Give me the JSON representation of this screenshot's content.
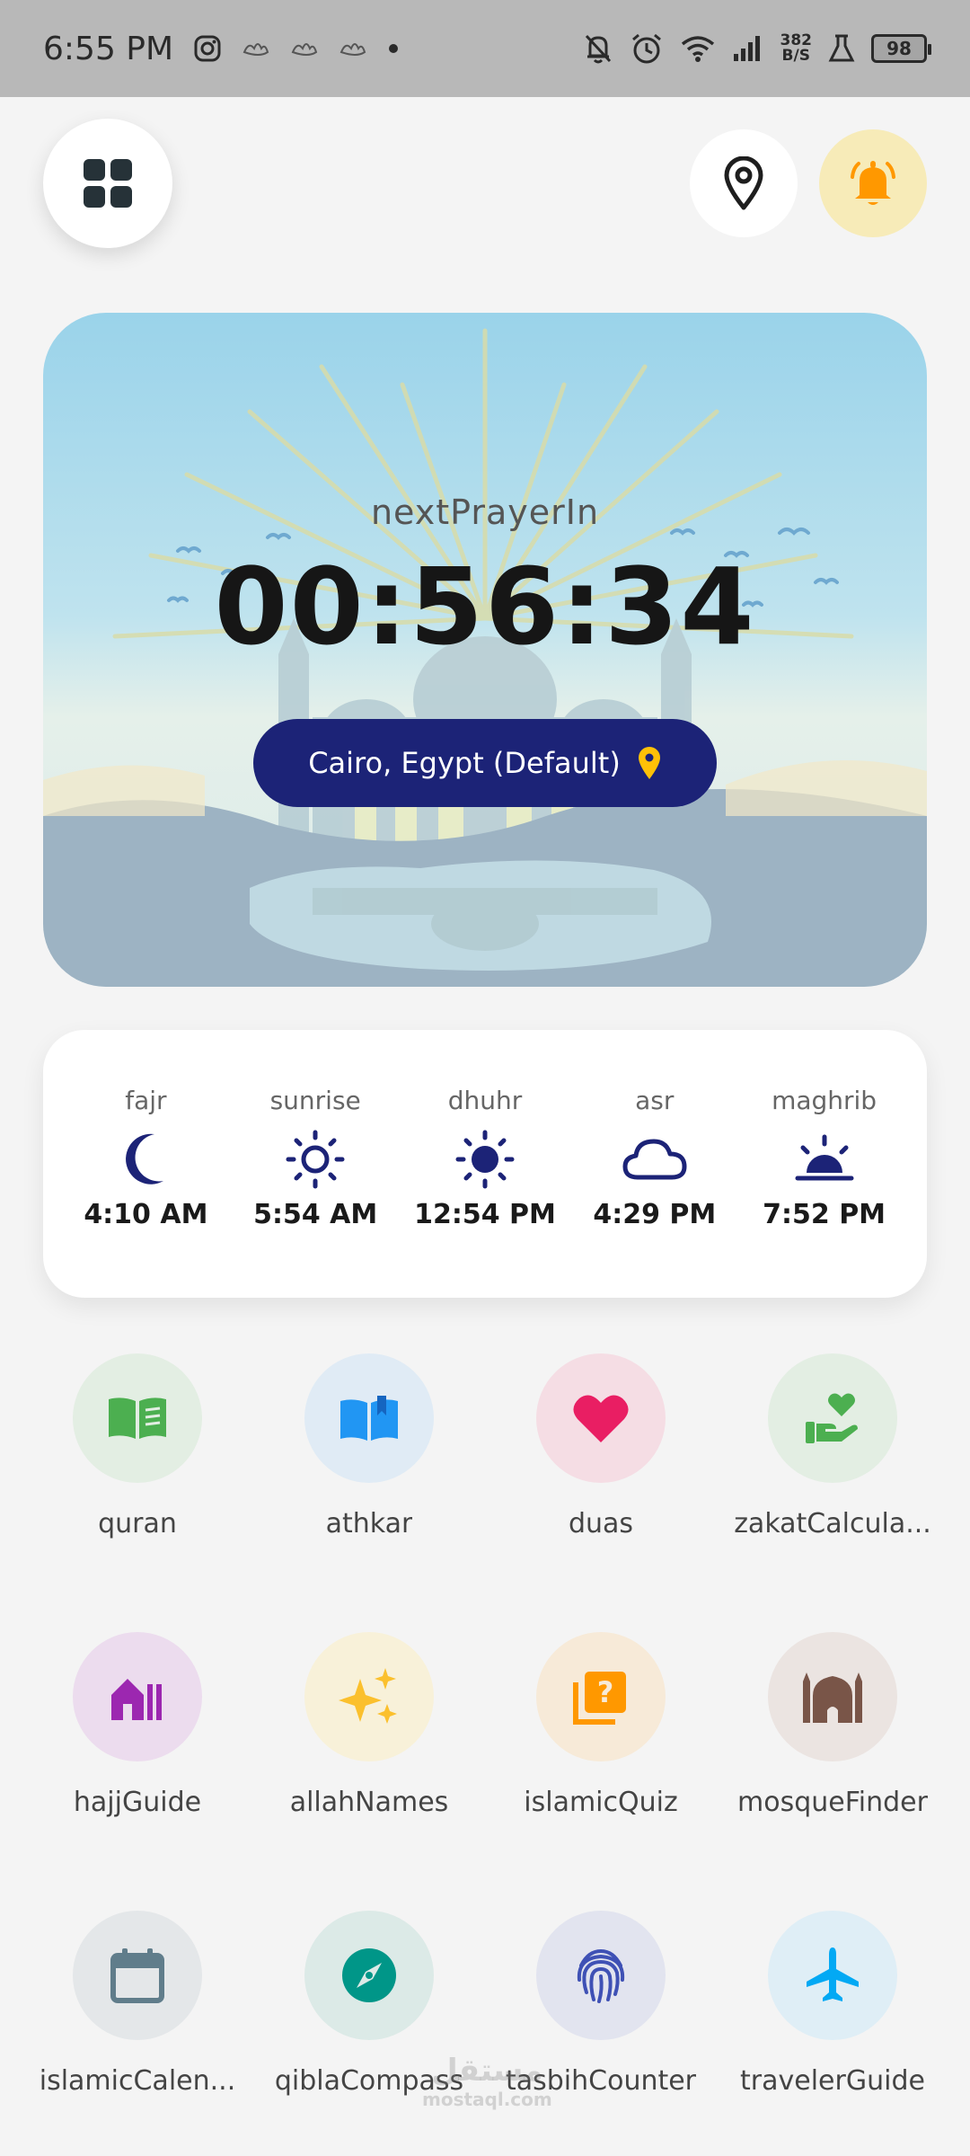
{
  "status_bar": {
    "time": "6:55 PM",
    "net_speed_value": "382",
    "net_speed_unit": "B/S",
    "battery": "98"
  },
  "hero": {
    "label": "nextPrayerIn",
    "countdown": "00:56:34",
    "location": "Cairo, Egypt (Default)"
  },
  "prayers": [
    {
      "name": "fajr",
      "time": "4:10 AM",
      "icon": "moon-icon"
    },
    {
      "name": "sunrise",
      "time": "5:54 AM",
      "icon": "sun-outline-icon"
    },
    {
      "name": "dhuhr",
      "time": "12:54 PM",
      "icon": "sun-icon"
    },
    {
      "name": "asr",
      "time": "4:29 PM",
      "icon": "cloud-icon"
    },
    {
      "name": "maghrib",
      "time": "7:52 PM",
      "icon": "sunset-icon"
    }
  ],
  "features": [
    {
      "label": "quran",
      "icon": "book-icon",
      "color": "#4caf50",
      "bg": "#e3eee3"
    },
    {
      "label": "athkar",
      "icon": "open-book-icon",
      "color": "#2196f3",
      "bg": "#e0ebf5"
    },
    {
      "label": "duas",
      "icon": "heart-icon",
      "color": "#e91e63",
      "bg": "#f5dde4"
    },
    {
      "label": "zakatCalcula...",
      "icon": "charity-hand-icon",
      "color": "#4caf50",
      "bg": "#e3eee3"
    },
    {
      "label": "hajjGuide",
      "icon": "kaaba-icon",
      "color": "#9c27b0",
      "bg": "#ecdcee"
    },
    {
      "label": "allahNames",
      "icon": "sparkles-icon",
      "color": "#fbc02d",
      "bg": "#f8f1d9"
    },
    {
      "label": "islamicQuiz",
      "icon": "quiz-icon",
      "color": "#ff9800",
      "bg": "#f7ead8"
    },
    {
      "label": "mosqueFinder",
      "icon": "mosque-icon",
      "color": "#795548",
      "bg": "#ebe4e1"
    },
    {
      "label": "islamicCalen...",
      "icon": "calendar-icon",
      "color": "#607d8b",
      "bg": "#e4e7e9"
    },
    {
      "label": "qiblaCompass",
      "icon": "compass-icon",
      "color": "#009688",
      "bg": "#dceae7"
    },
    {
      "label": "tasbihCounter",
      "icon": "fingerprint-icon",
      "color": "#3f51b5",
      "bg": "#e2e4ef"
    },
    {
      "label": "travelerGuide",
      "icon": "airplane-icon",
      "color": "#03a9f4",
      "bg": "#dfeef6"
    }
  ],
  "colors": {
    "accent": "#1c2377",
    "bell_bg": "#f7ebb8",
    "bell": "#ff9800",
    "pin": "#ffc107"
  },
  "watermark": {
    "text": "مستقل",
    "sub": "mostaql.com"
  }
}
